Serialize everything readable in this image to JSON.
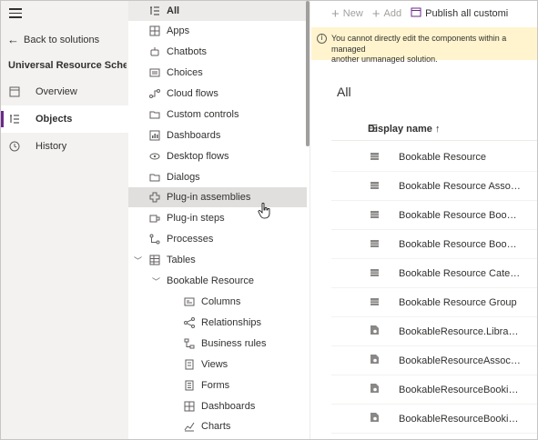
{
  "rail": {
    "back_label": "Back to solutions",
    "solution_title": "Universal Resource Sche...",
    "items": [
      {
        "label": "Overview",
        "icon": "overview-icon"
      },
      {
        "label": "Objects",
        "icon": "objects-icon"
      },
      {
        "label": "History",
        "icon": "history-icon"
      }
    ]
  },
  "tree": {
    "items": [
      {
        "label": "All",
        "icon": "list-icon"
      },
      {
        "label": "Apps",
        "icon": "apps-icon"
      },
      {
        "label": "Chatbots",
        "icon": "bot-icon"
      },
      {
        "label": "Choices",
        "icon": "choices-icon"
      },
      {
        "label": "Cloud flows",
        "icon": "flow-icon"
      },
      {
        "label": "Custom controls",
        "icon": "folder-icon"
      },
      {
        "label": "Dashboards",
        "icon": "dashboard-icon"
      },
      {
        "label": "Desktop flows",
        "icon": "desktop-flow-icon"
      },
      {
        "label": "Dialogs",
        "icon": "folder-icon"
      },
      {
        "label": "Plug-in assemblies",
        "icon": "plugin-icon"
      },
      {
        "label": "Plug-in steps",
        "icon": "plugin-step-icon"
      },
      {
        "label": "Processes",
        "icon": "process-icon"
      },
      {
        "label": "Tables",
        "icon": "table-icon"
      },
      {
        "label": "Bookable Resource",
        "icon": ""
      },
      {
        "label": "Columns",
        "icon": "columns-icon"
      },
      {
        "label": "Relationships",
        "icon": "relationships-icon"
      },
      {
        "label": "Business rules",
        "icon": "business-rules-icon"
      },
      {
        "label": "Views",
        "icon": "views-icon"
      },
      {
        "label": "Forms",
        "icon": "forms-icon"
      },
      {
        "label": "Dashboards",
        "icon": "dashboard-icon"
      },
      {
        "label": "Charts",
        "icon": "charts-icon"
      }
    ]
  },
  "cmdbar": {
    "new_label": "New",
    "add_label": "Add",
    "publish_label": "Publish all customi"
  },
  "banner": {
    "text": "You cannot directly edit the components within a managed\nanother unmanaged solution."
  },
  "main": {
    "heading": "All",
    "column_header": "Display name ↑",
    "rows": [
      {
        "name": "Bookable Resource",
        "icon": "table-icon"
      },
      {
        "name": "Bookable Resource Associat...",
        "icon": "table-icon"
      },
      {
        "name": "Bookable Resource Booking",
        "icon": "table-icon"
      },
      {
        "name": "Bookable Resource Booking...",
        "icon": "table-icon"
      },
      {
        "name": "Bookable Resource Category",
        "icon": "table-icon"
      },
      {
        "name": "Bookable Resource Group",
        "icon": "table-icon"
      },
      {
        "name": "BookableResource.Library.js",
        "icon": "webresource-icon"
      },
      {
        "name": "BookableResourceAssociati...",
        "icon": "webresource-icon"
      },
      {
        "name": "BookableResourceBooking....",
        "icon": "webresource-icon"
      },
      {
        "name": "BookableResourceBooking...",
        "icon": "webresource-icon"
      }
    ]
  }
}
